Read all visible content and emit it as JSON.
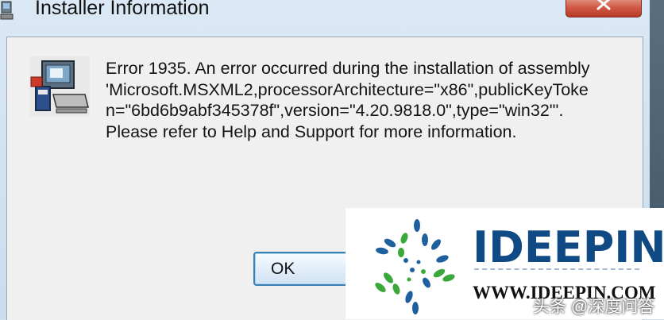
{
  "window": {
    "title": "Installer Information",
    "title_icon": "installer-title-icon",
    "close_icon": "close-icon"
  },
  "dialog": {
    "icon": "installer-computer-icon",
    "message_lines": [
      "Error 1935. An error occurred during the installation of assembly",
      "'Microsoft.MSXML2,processorArchitecture=\"x86\",publicKeyToke",
      "n=\"6bd6b9abf345378f\",version=\"4.20.9818.0\",type=\"win32\"'.",
      "Please refer to Help and Support for more information."
    ],
    "ok_label": "OK"
  },
  "watermark": {
    "brand": "IDEEPIN",
    "url": "WWW.IDEEPIN.COM",
    "caption": "头条 @深度问答",
    "colors": {
      "brand": "#0f4a84",
      "blue_dots": "#1e5fa0",
      "green_dots": "#3aa83a"
    }
  },
  "colors": {
    "close_button": "#c9503a",
    "ok_border": "#3c7fb1",
    "dialog_bg": "#f0f0f0"
  }
}
